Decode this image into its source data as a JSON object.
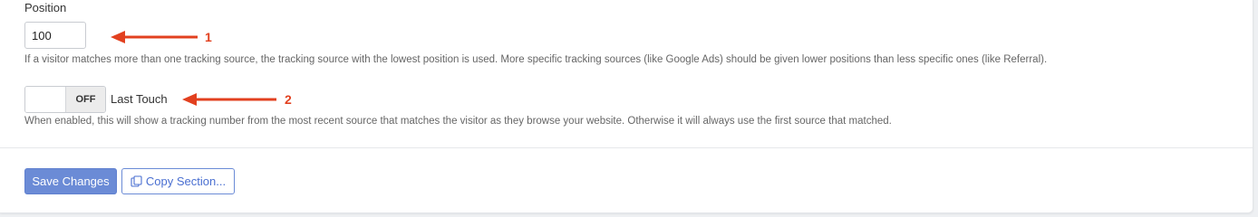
{
  "position": {
    "label": "Position",
    "value": "100",
    "help": "If a visitor matches more than one tracking source, the tracking source with the lowest position is used. More specific tracking sources (like Google Ads) should be given lower positions than less specific ones (like Referral)."
  },
  "last_touch": {
    "state": "OFF",
    "label": "Last Touch",
    "help": "When enabled, this will show a tracking number from the most recent source that matches the visitor as they browse your website. Otherwise it will always use the first source that matched."
  },
  "actions": {
    "save_label": "Save Changes",
    "copy_label": "Copy Section...",
    "copy_icon": "copy-icon"
  },
  "annotations": {
    "arrow1_label": "1",
    "arrow2_label": "2",
    "arrow_color": "#e2401f"
  },
  "colors": {
    "primary": "#6b8bd6",
    "link": "#4a6fd1"
  }
}
